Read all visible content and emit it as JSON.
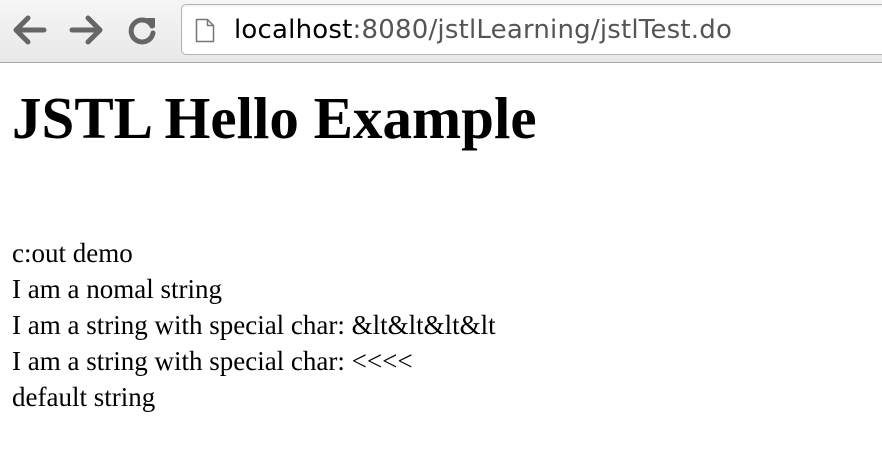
{
  "browser": {
    "url_host": "localhost",
    "url_rest": ":8080/jstlLearning/jstlTest.do",
    "icons": {
      "back": "back-arrow-icon",
      "forward": "forward-arrow-icon",
      "reload": "reload-icon",
      "page": "page-document-icon"
    }
  },
  "page": {
    "title": "JSTL Hello Example",
    "lines": [
      "c:out demo",
      "I am a nomal string",
      "I am a string with special char: &lt&lt&lt&lt",
      "I am a string with special char: <<<<",
      "default string"
    ]
  }
}
